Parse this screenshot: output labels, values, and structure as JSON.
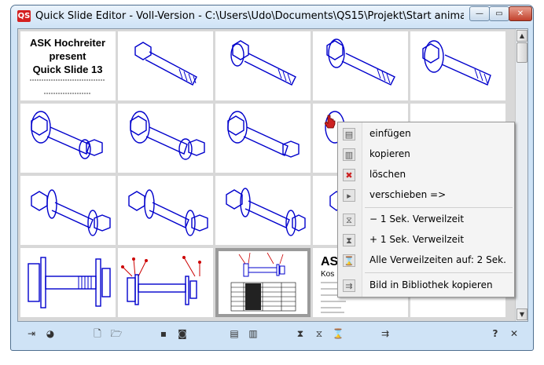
{
  "window": {
    "logo": "QS",
    "title": "Quick Slide Editor - Voll-Version - C:\\Users\\Udo\\Documents\\QS15\\Projekt\\Start animation Schra...",
    "controls": {
      "minimize": "—",
      "maximize": "▭",
      "close": "✕"
    }
  },
  "title_slide": {
    "line1": "ASK Hochreiter",
    "line2": "present",
    "line3": "Quick Slide 13"
  },
  "partial_slide": {
    "heading": "ASK",
    "sub": "Kos"
  },
  "context_menu": {
    "items": [
      {
        "label": "einfügen",
        "icon": "insert-icon"
      },
      {
        "label": "kopieren",
        "icon": "copy-icon"
      },
      {
        "label": "löschen",
        "icon": "delete-icon"
      },
      {
        "label": "verschieben =>",
        "icon": "move-icon"
      },
      {
        "label": "− 1 Sek. Verweilzeit",
        "icon": "hourglass-minus-icon"
      },
      {
        "label": "+ 1 Sek. Verweilzeit",
        "icon": "hourglass-plus-icon"
      },
      {
        "label": "Alle Verweilzeiten auf: 2 Sek.",
        "icon": "hourglass-icon"
      },
      {
        "label": "Bild in Bibliothek kopieren",
        "icon": "library-copy-icon"
      }
    ]
  },
  "toolbar": {
    "help": "?",
    "close": "✕"
  },
  "colors": {
    "drawing": "#0000cc",
    "annotation": "#cc0000",
    "selection": "#9a9a9a"
  }
}
